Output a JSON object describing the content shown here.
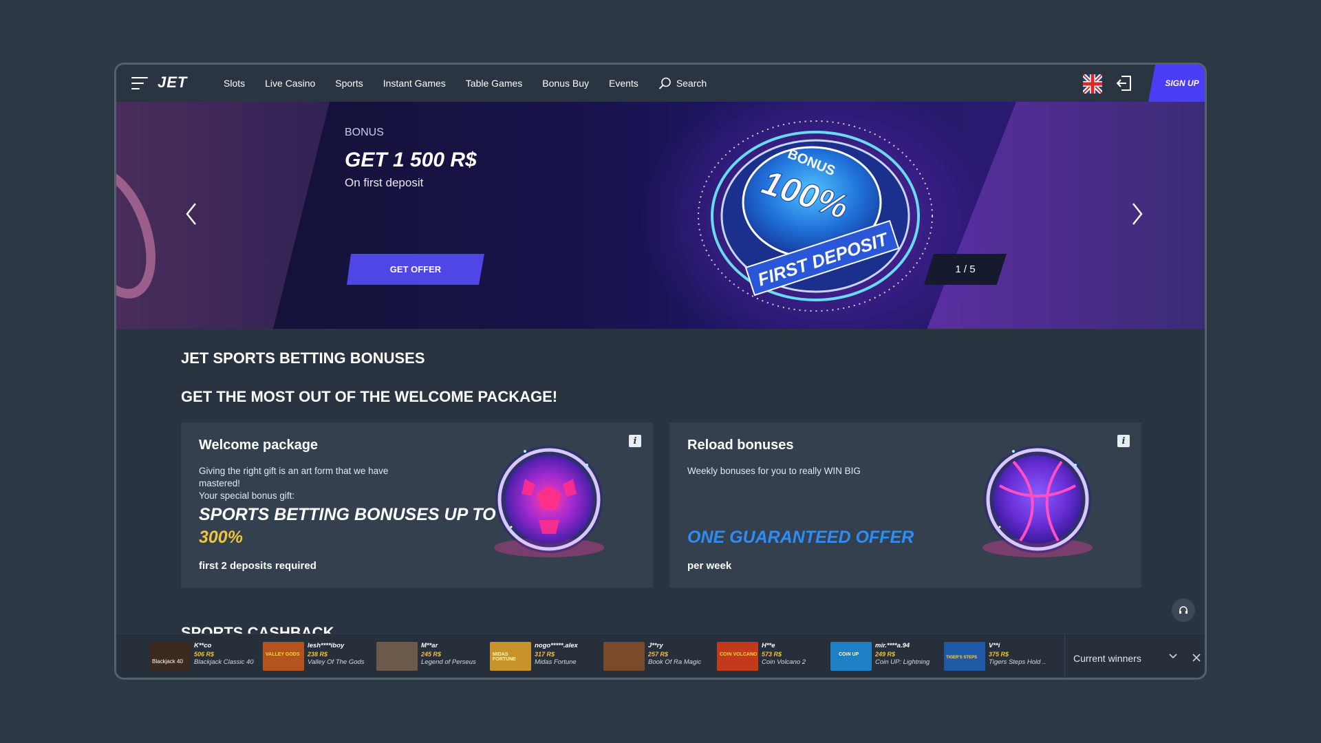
{
  "header": {
    "logo": "JET",
    "nav": [
      "Slots",
      "Live Casino",
      "Sports",
      "Instant Games",
      "Table Games",
      "Bonus Buy",
      "Events"
    ],
    "search_label": "Search",
    "signup_label": "SIGN UP"
  },
  "banner": {
    "eyebrow": "BONUS",
    "title": "GET 1 500 R$",
    "subtitle": "On first deposit",
    "cta": "GET OFFER",
    "counter": "1 / 5",
    "coin_text_top": "BONUS",
    "coin_text_mid": "100%",
    "coin_text_bottom": "FIRST DEPOSIT"
  },
  "sections": {
    "title1": "JET SPORTS BETTING BONUSES",
    "title2": "GET THE MOST OUT OF THE WELCOME PACKAGE!",
    "title3": "SPORTS CASHBACK"
  },
  "cards": [
    {
      "title": "Welcome package",
      "text1": "Giving the right gift is an art form that we have",
      "text2": "mastered!",
      "text3": "Your special bonus gift:",
      "big1": "SPORTS BETTING BONUSES UP TO",
      "big2": "300%",
      "foot": "first 2 deposits required"
    },
    {
      "title": "Reload bonuses",
      "text1": "Weekly bonuses for you to really WIN BIG",
      "big1": "ONE GUARANTEED OFFER",
      "foot": "per week"
    }
  ],
  "winners": {
    "items": [
      {
        "name": "K**co",
        "amount": "506 R$",
        "game": "Blackjack Classic 40",
        "thumb_label": "Blackjack 40",
        "color": "#3a2a20"
      },
      {
        "name": "lesh****iboy",
        "amount": "238 R$",
        "game": "Valley Of The Gods",
        "thumb_label": "VALLEY GODS",
        "color": "#b5531f"
      },
      {
        "name": "M**ar",
        "amount": "245 R$",
        "game": "Legend of Perseus",
        "thumb_label": "",
        "color": "#6b5a4a"
      },
      {
        "name": "nogo*****.alex",
        "amount": "317 R$",
        "game": "Midas Fortune",
        "thumb_label": "MIDAS FORTUNE",
        "color": "#c8932a"
      },
      {
        "name": "J**ry",
        "amount": "257 R$",
        "game": "Book Of Ra Magic",
        "thumb_label": "",
        "color": "#7a4a2a"
      },
      {
        "name": "H**e",
        "amount": "573 R$",
        "game": "Coin Volcano 2",
        "thumb_label": "COIN VOLCANO",
        "color": "#c23a1a"
      },
      {
        "name": "mir.****a.94",
        "amount": "249 R$",
        "game": "Coin UP: Lightning",
        "thumb_label": "COIN UP",
        "color": "#1d7fc4"
      },
      {
        "name": "V**i",
        "amount": "375 R$",
        "game": "Tigers Steps Hold ..",
        "thumb_label": "TIGER'S STEPS",
        "color": "#1f5aa8"
      }
    ],
    "select_label": "Current winners"
  },
  "colors": {
    "accent": "#4f46e5",
    "gold": "#f0c33c",
    "blue_text": "#2e8df5"
  }
}
